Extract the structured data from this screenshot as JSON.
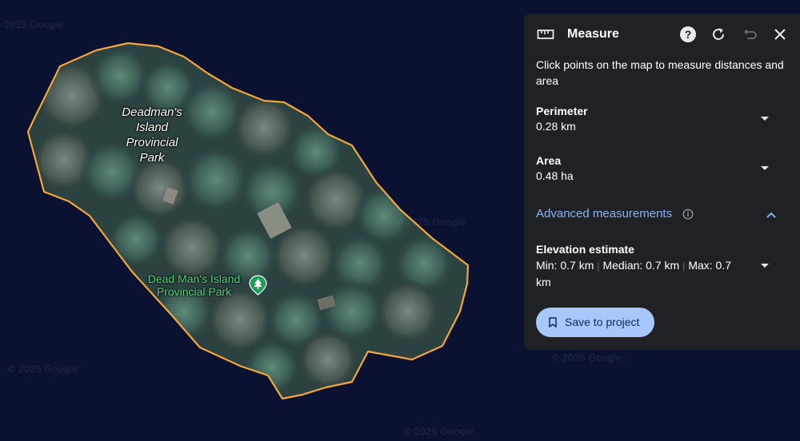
{
  "map": {
    "watermark": "© 2025 Google",
    "label_island": "Deadman's\nIsland\nProvincial\nPark",
    "label_poi": "Dead Man's Island\nProvincial Park",
    "outline_color": "#f3a73a"
  },
  "panel": {
    "title": "Measure",
    "description": "Click points on the map to measure distances and area",
    "perimeter": {
      "label": "Perimeter",
      "value": "0.28 km"
    },
    "area": {
      "label": "Area",
      "value": "0.48 ha"
    },
    "advanced": {
      "label": "Advanced measurements"
    },
    "elevation": {
      "label": "Elevation estimate",
      "min": "Min: 0.7 km",
      "median": "Median: 0.7 km",
      "max": "Max: 0.7",
      "max_unit": "km"
    },
    "save_label": "Save to project",
    "icons": [
      "ruler-icon",
      "help-icon",
      "refresh-icon",
      "undo-icon",
      "close-icon",
      "chevron-down-icon",
      "info-icon",
      "chevron-up-icon",
      "bookmark-icon"
    ],
    "accent_color": "#8ab4f8",
    "button_color": "#a8c7fa"
  }
}
